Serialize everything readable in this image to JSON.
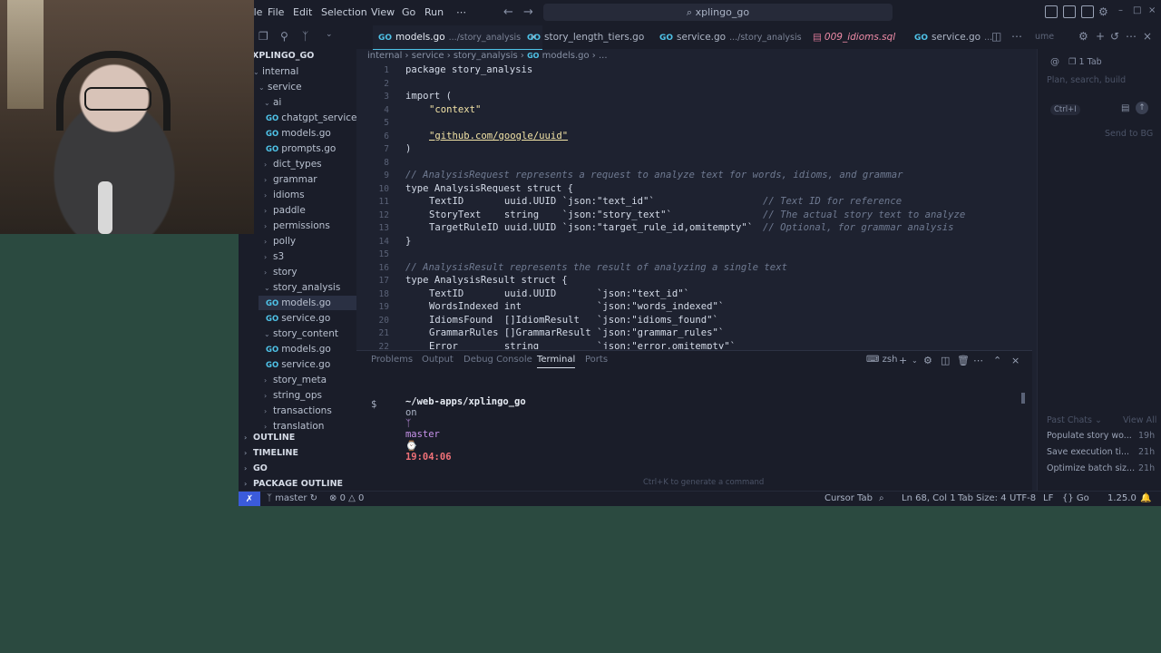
{
  "titlebar": {
    "menu": [
      "File",
      "Edit",
      "Selection",
      "View",
      "Go",
      "Run",
      "⋯"
    ],
    "search": "xplingo_go"
  },
  "tabs": [
    {
      "label": "models.go",
      "path": ".../story_analysis",
      "active": true
    },
    {
      "label": "story_length_tiers.go",
      "path": ""
    },
    {
      "label": "service.go",
      "path": ".../story_analysis"
    },
    {
      "label": "009_idioms.sql",
      "path": ""
    },
    {
      "label": "service.go",
      "path": "..."
    },
    {
      "label": "ume",
      "path": ""
    }
  ],
  "explorer": {
    "root": "XPLINGO_GO",
    "items": [
      {
        "label": "internal",
        "type": "folder"
      },
      {
        "label": "service",
        "type": "folder"
      },
      {
        "label": "ai",
        "type": "folder"
      },
      {
        "label": "chatgpt_service...",
        "type": "file"
      },
      {
        "label": "models.go",
        "type": "file"
      },
      {
        "label": "prompts.go",
        "type": "file"
      },
      {
        "label": "dict_types",
        "type": "folder"
      },
      {
        "label": "grammar",
        "type": "folder"
      },
      {
        "label": "idioms",
        "type": "folder"
      },
      {
        "label": "paddle",
        "type": "folder"
      },
      {
        "label": "permissions",
        "type": "folder"
      },
      {
        "label": "polly",
        "type": "folder"
      },
      {
        "label": "s3",
        "type": "folder"
      },
      {
        "label": "story",
        "type": "folder"
      },
      {
        "label": "story_analysis",
        "type": "folder"
      },
      {
        "label": "models.go",
        "type": "file"
      },
      {
        "label": "service.go",
        "type": "file"
      },
      {
        "label": "story_content",
        "type": "folder"
      },
      {
        "label": "models.go",
        "type": "file"
      },
      {
        "label": "service.go",
        "type": "file"
      },
      {
        "label": "story_meta",
        "type": "folder"
      },
      {
        "label": "string_ops",
        "type": "folder"
      },
      {
        "label": "transactions",
        "type": "folder"
      },
      {
        "label": "translation",
        "type": "folder"
      }
    ],
    "sections": [
      "OUTLINE",
      "TIMELINE",
      "GO",
      "PACKAGE OUTLINE"
    ]
  },
  "breadcrumb": [
    "internal",
    "service",
    "story_analysis",
    "models.go",
    "..."
  ],
  "code": {
    "line_numbers": [
      "1",
      "2",
      "3",
      "4",
      "5",
      "6",
      "7",
      "8",
      "9",
      "10",
      "11",
      "12",
      "13",
      "14",
      "15",
      "16",
      "17",
      "18",
      "19",
      "20",
      "21",
      "22"
    ],
    "pkg": "package story_analysis",
    "import_open": "import (",
    "imp1": "\"context\"",
    "imp2": "\"github.com/google/uuid\"",
    "close_paren": ")",
    "c1": "// AnalysisRequest represents a request to analyze text for words, idioms, and grammar",
    "t1": "type AnalysisRequest struct {",
    "f1": "TextID       uuid.UUID `json:\"text_id\"`",
    "f1c": "// Text ID for reference",
    "f2": "StoryText    string    `json:\"story_text\"`",
    "f2c": "// The actual story text to analyze",
    "f3": "TargetRuleID uuid.UUID `json:\"target_rule_id,omitempty\"`",
    "f3c": "// Optional, for grammar analysis",
    "close_brace": "}",
    "c2": "// AnalysisResult represents the result of analyzing a single text",
    "t2": "type AnalysisResult struct {",
    "g1": "TextID       uuid.UUID       `json:\"text_id\"`",
    "g2": "WordsIndexed int             `json:\"words_indexed\"`",
    "g3": "IdiomsFound  []IdiomResult   `json:\"idioms_found\"`",
    "g4": "GrammarRules []GrammarResult `json:\"grammar_rules\"`",
    "g5": "Error        string          `json:\"error,omitempty\"`"
  },
  "panel": {
    "tabs": [
      "Problems",
      "Output",
      "Debug Console",
      "Terminal",
      "Ports"
    ],
    "shell": "zsh",
    "prompt_path": "~/web-apps/xplingo_go",
    "prompt_on": "on",
    "branch": "master",
    "time": "19:04:06",
    "cursor": "$",
    "hint": "Ctrl+K to generate a command"
  },
  "chat": {
    "tab": "1 Tab",
    "placeholder": "Plan, search, build",
    "mode": "Ctrl+I",
    "send": "Send to BG",
    "past_chats": "Past Chats",
    "view_all": "View All",
    "history": [
      {
        "title": "Populate story wo...",
        "age": "19h"
      },
      {
        "title": "Save execution ti...",
        "age": "21h"
      },
      {
        "title": "Optimize batch siz...",
        "age": "21h"
      }
    ]
  },
  "statusbar": {
    "branch": "master",
    "errors": "0",
    "warnings": "0",
    "cursor_tab": "Cursor Tab",
    "position": "Ln 68, Col 1",
    "tab_size": "Tab Size: 4",
    "encoding": "UTF-8",
    "eol": "LF",
    "language": "Go",
    "go_version": "1.25.0"
  }
}
